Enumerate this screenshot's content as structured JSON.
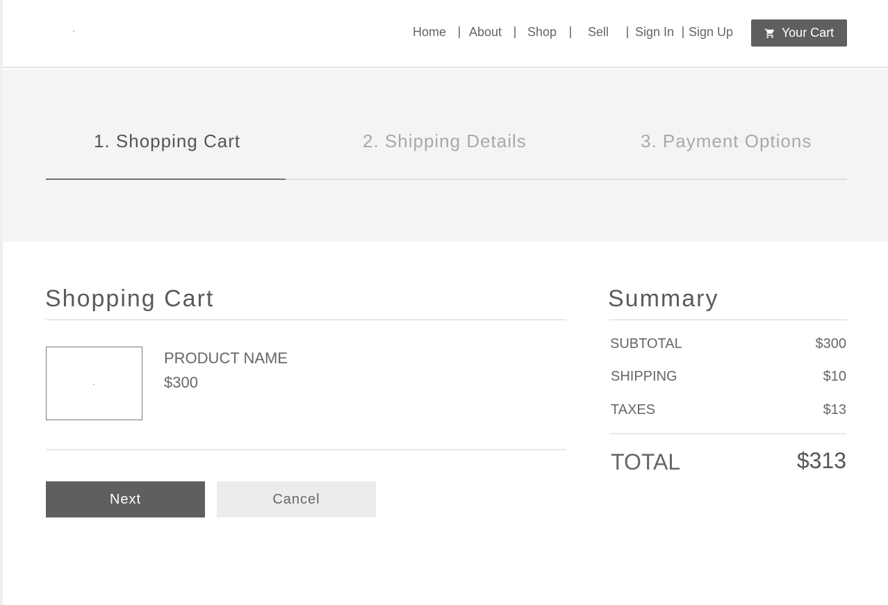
{
  "nav": {
    "links": [
      "Home",
      "About",
      "Shop",
      "Sell",
      "Sign In",
      "Sign Up"
    ],
    "cart_button": "Your Cart"
  },
  "steps": [
    {
      "label": "1. Shopping Cart",
      "state": "active"
    },
    {
      "label": "2. Shipping Details",
      "state": "inactive"
    },
    {
      "label": "3. Payment Options",
      "state": "inactive"
    }
  ],
  "cart": {
    "title": "Shopping Cart",
    "items": [
      {
        "name": "PRODUCT NAME",
        "price": "$300"
      }
    ],
    "next_label": "Next",
    "cancel_label": "Cancel"
  },
  "summary": {
    "title": "Summary",
    "rows": [
      {
        "label": "SUBTOTAL",
        "value": "$300"
      },
      {
        "label": "SHIPPING",
        "value": "$10"
      },
      {
        "label": "TAXES",
        "value": "$13"
      }
    ],
    "total_label": "TOTAL",
    "total_value": "$313"
  },
  "colors": {
    "accent_dark": "#5f5f5f",
    "band_bg": "#f4f4f4",
    "inactive_text": "#a9a9a9"
  },
  "icons": {
    "cart": "shopping-cart-icon"
  }
}
